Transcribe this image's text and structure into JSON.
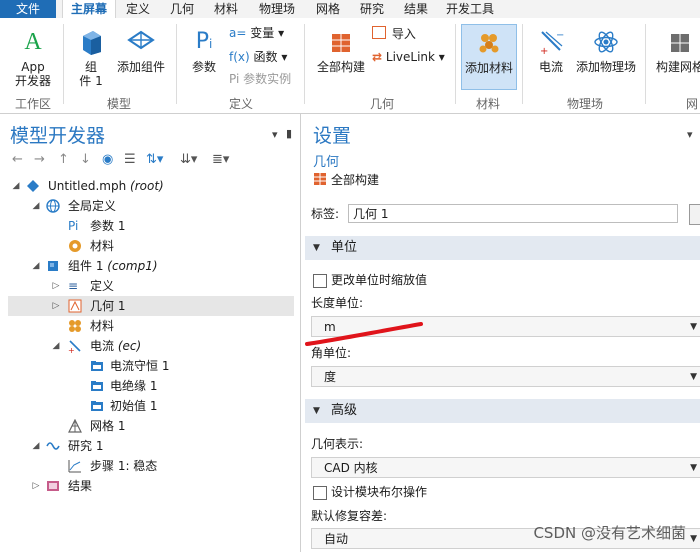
{
  "menu": {
    "file": "文件",
    "items": [
      "主屏幕",
      "定义",
      "几何",
      "材料",
      "物理场",
      "网格",
      "研究",
      "结果",
      "开发工具"
    ]
  },
  "ribbon": {
    "app_builder": "App\n开发器",
    "app_builder_l1": "App",
    "app_builder_l2": "开发器",
    "component": "组\n件 1",
    "component_l1": "组",
    "component_l2": "件 1",
    "add_component": "添加组件",
    "parameters": "参数",
    "variables": "变量",
    "functions": "函数",
    "param_instance": "参数实例",
    "build_all": "全部构建",
    "import": "导入",
    "livelink": "LiveLink",
    "add_material": "添加材料",
    "current": "电流",
    "add_physics": "添加物理场",
    "build_mesh": "构建网格",
    "groups": {
      "workspace": "工作区",
      "model": "模型",
      "definitions": "定义",
      "geometry": "几何",
      "materials": "材料",
      "physics": "物理场",
      "mesh": "网"
    }
  },
  "model_builder": {
    "title": "模型开发器",
    "tree": [
      {
        "label": "Untitled.mph",
        "suffix": "(root)",
        "icon": "model-root-icon"
      },
      {
        "label": "全局定义",
        "icon": "globe-icon"
      },
      {
        "label": "参数 1",
        "icon": "parameter-icon"
      },
      {
        "label": "材料",
        "icon": "material-icon"
      },
      {
        "label": "组件 1",
        "suffix": "(comp1)",
        "icon": "component-icon"
      },
      {
        "label": "定义",
        "icon": "definitions-icon"
      },
      {
        "label": "几何 1",
        "icon": "geometry-icon"
      },
      {
        "label": "材料",
        "icon": "material-icon"
      },
      {
        "label": "电流",
        "suffix": "(ec)",
        "icon": "electric-currents-icon"
      },
      {
        "label": "电流守恒 1",
        "icon": "folder-node-icon"
      },
      {
        "label": "电绝缘 1",
        "icon": "folder-node-icon"
      },
      {
        "label": "初始值 1",
        "icon": "folder-node-icon"
      },
      {
        "label": "网格 1",
        "icon": "mesh-icon"
      },
      {
        "label": "研究 1",
        "icon": "study-icon"
      },
      {
        "label": "步骤 1: 稳态",
        "icon": "stationary-step-icon"
      },
      {
        "label": "结果",
        "icon": "results-icon"
      }
    ]
  },
  "settings": {
    "title": "设置",
    "subtitle": "几何",
    "build_all": "全部构建",
    "label_caption": "标签:",
    "label_value": "几何 1",
    "units_section": "单位",
    "scale_checkbox": "更改单位时缩放值",
    "length_unit_label": "长度单位:",
    "length_unit_value": "m",
    "angle_unit_label": "角单位:",
    "angle_unit_value": "度",
    "advanced_section": "高级",
    "geom_rep_label": "几何表示:",
    "geom_rep_value": "CAD 内核",
    "boolean_checkbox": "设计模块布尔操作",
    "repair_tol_label": "默认修复容差:",
    "repair_tol_value": "自动"
  },
  "watermark": "CSDN @没有艺术细菌",
  "colors": {
    "accent": "#2b78c2",
    "file_menu": "#1f6db6",
    "section_bg": "#e3e9f1",
    "selected_row": "#e6e6e6",
    "annotation": "#e0141b"
  }
}
